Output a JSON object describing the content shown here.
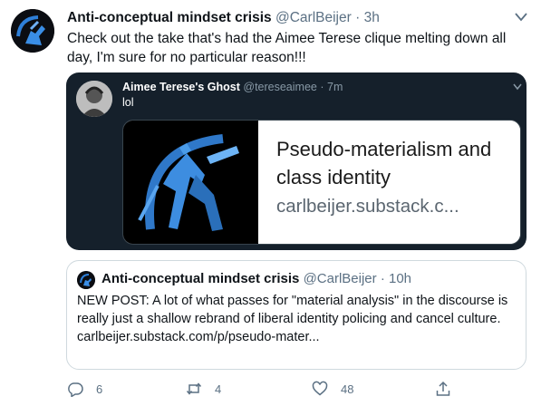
{
  "tweet": {
    "author_name": "Anti-conceptual mindset crisis",
    "author_handle": "@CarlBeijer",
    "separator": "·",
    "time": "3h",
    "text": "Check out the take that's had the Aimee Terese clique melting down all day, I'm sure for no particular reason!!!"
  },
  "embedded_screenshot": {
    "author_name": "Aimee Terese's Ghost",
    "author_handle": "@tereseaimee",
    "separator": "·",
    "time": "7m",
    "text": "lol",
    "link_card": {
      "title": "Pseudo-materialism and class identity",
      "url": "carlbeijer.substack.c..."
    }
  },
  "quoted_tweet": {
    "author_name": "Anti-conceptual mindset crisis",
    "author_handle": "@CarlBeijer",
    "separator": "·",
    "time": "10h",
    "text": "NEW POST: A lot of what passes for \"material analysis\" in the discourse is really just a shallow rebrand of liberal identity policing and cancel culture.",
    "link": "carlbeijer.substack.com/p/pseudo-mater..."
  },
  "actions": {
    "reply_count": "6",
    "retweet_count": "4",
    "like_count": "48",
    "icons": [
      "reply-icon",
      "retweet-icon",
      "like-icon",
      "share-icon"
    ]
  },
  "colors": {
    "text_primary": "#0f1419",
    "text_secondary": "#5b7083",
    "dark_background": "#15202b",
    "accent_blue": "#2e7fd8"
  }
}
